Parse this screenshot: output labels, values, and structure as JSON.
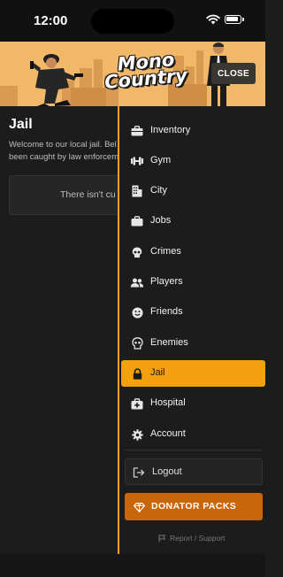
{
  "status_bar": {
    "time": "12:00"
  },
  "header": {
    "logo_line1": "Mono",
    "logo_line2": "Country",
    "close_label": "CLOSE"
  },
  "page": {
    "title": "Jail",
    "intro_line1": "Welcome to our local jail. Bel",
    "intro_line2": "been caught by law enforcem",
    "empty_text": "There isn't cu"
  },
  "drawer": {
    "items": [
      {
        "label": "Inventory",
        "icon": "briefcase-icon"
      },
      {
        "label": "Gym",
        "icon": "dumbbell-icon"
      },
      {
        "label": "City",
        "icon": "building-icon"
      },
      {
        "label": "Jobs",
        "icon": "briefcase-icon"
      },
      {
        "label": "Crimes",
        "icon": "skull-icon"
      },
      {
        "label": "Players",
        "icon": "users-icon"
      },
      {
        "label": "Friends",
        "icon": "smile-icon"
      },
      {
        "label": "Enemies",
        "icon": "skull-icon"
      },
      {
        "label": "Jail",
        "icon": "lock-icon",
        "active": true
      },
      {
        "label": "Hospital",
        "icon": "medical-kit-icon"
      },
      {
        "label": "Account",
        "icon": "gear-icon"
      }
    ],
    "logout_label": "Logout",
    "donate_label": "DONATOR PACKS",
    "report_label": "Report / Support"
  },
  "colors": {
    "accent": "#f5a00f",
    "donate": "#c9650a",
    "banner": "#f2b86a",
    "background": "#1c1c1c"
  }
}
